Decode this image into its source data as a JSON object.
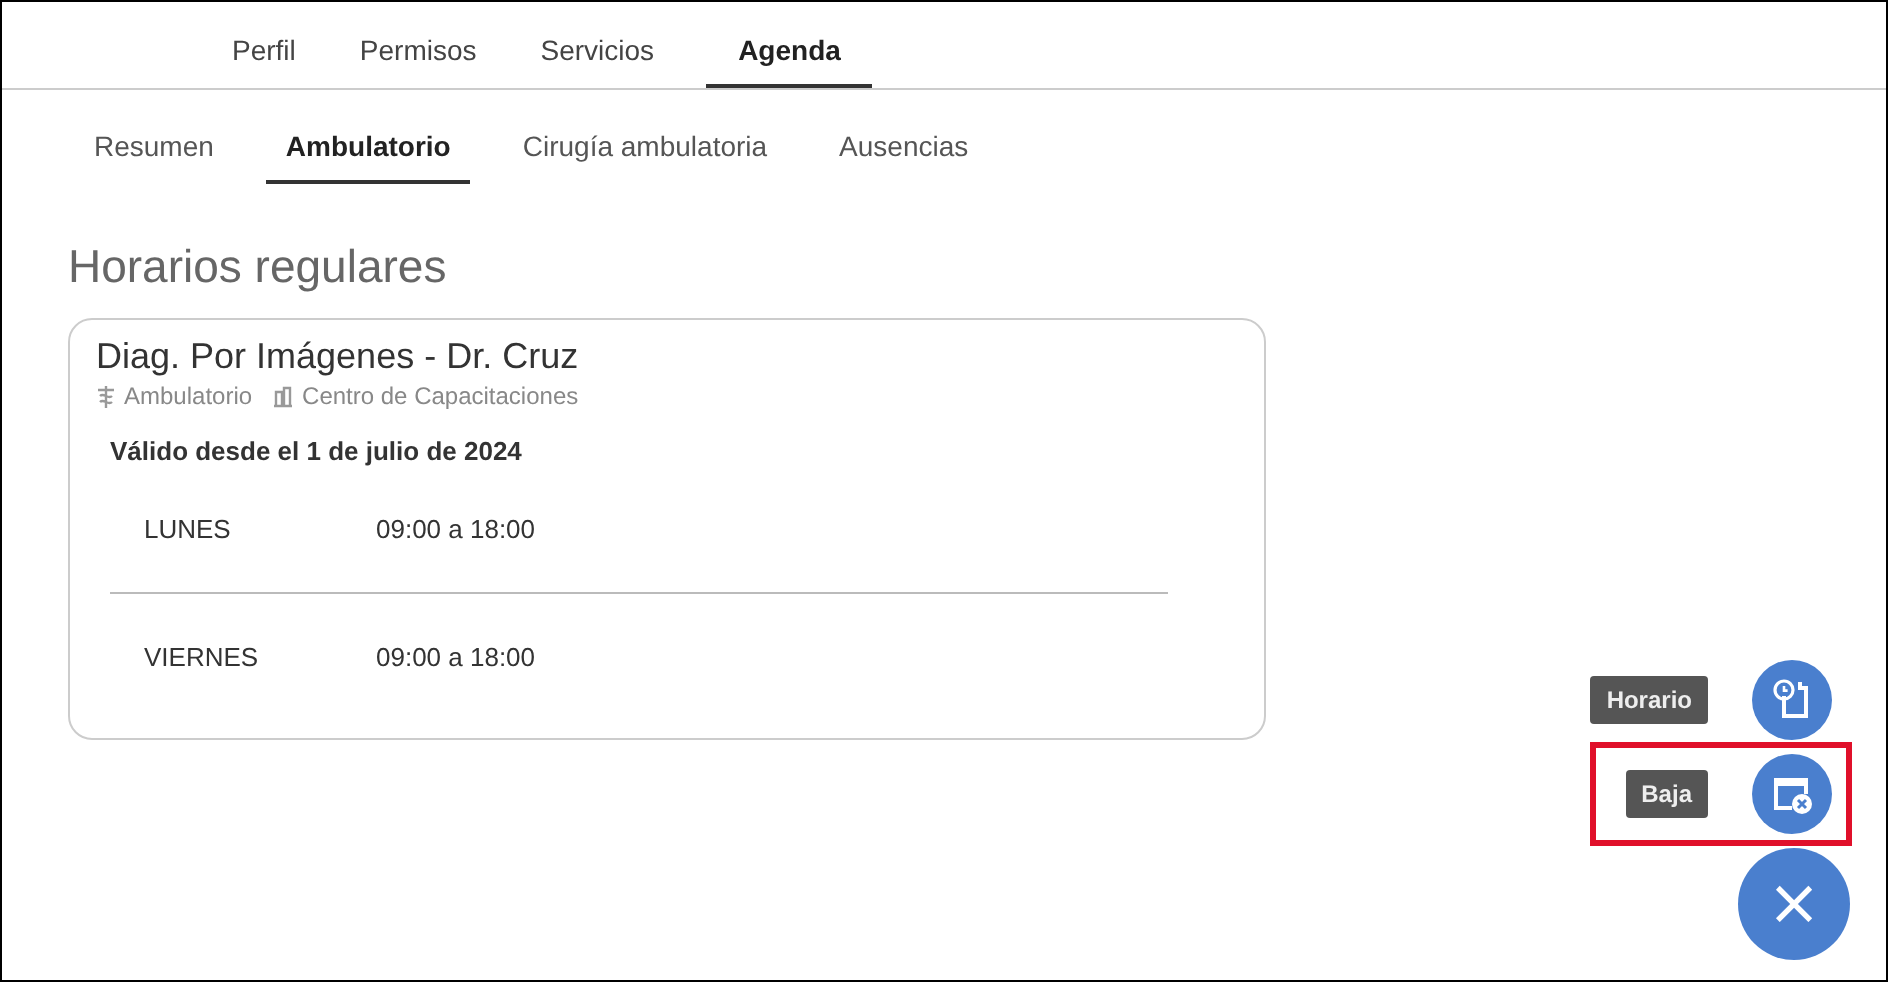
{
  "main_tabs": [
    {
      "label": "Perfil",
      "selected": false
    },
    {
      "label": "Permisos",
      "selected": false
    },
    {
      "label": "Servicios",
      "selected": false
    },
    {
      "label": "Agenda",
      "selected": true
    }
  ],
  "sub_tabs": [
    {
      "label": "Resumen",
      "selected": false
    },
    {
      "label": "Ambulatorio",
      "selected": true
    },
    {
      "label": "Cirugía ambulatoria",
      "selected": false
    },
    {
      "label": "Ausencias",
      "selected": false
    }
  ],
  "section_title": "Horarios regulares",
  "card": {
    "title": "Diag. Por Imágenes - Dr. Cruz",
    "type": "Ambulatorio",
    "location": "Centro de Capacitaciones",
    "valid_from": "Válido desde el 1 de julio de 2024",
    "schedule": [
      {
        "day": "LUNES",
        "hours": "09:00 a 18:00"
      },
      {
        "day": "VIERNES",
        "hours": "09:00 a 18:00"
      }
    ]
  },
  "fab_actions": [
    {
      "label": "Horario",
      "kind": "schedule",
      "highlighted": false
    },
    {
      "label": "Baja",
      "kind": "remove",
      "highlighted": true
    }
  ],
  "fab_close": "×"
}
